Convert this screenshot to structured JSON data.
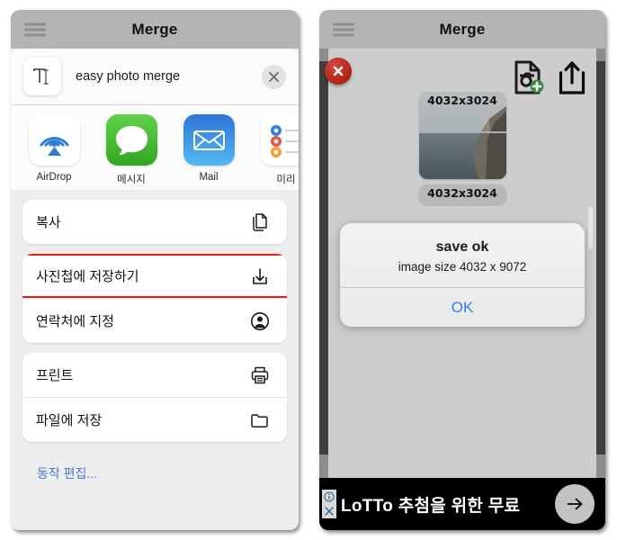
{
  "left_panel": {
    "titlebar": {
      "menu_icon": "hamburger-icon",
      "title": "Merge"
    },
    "share_sheet": {
      "app_icon": "text-cursor-icon",
      "app_name": "easy photo merge",
      "close_icon": "close-icon",
      "apps": [
        {
          "label": "AirDrop",
          "icon": "airdrop-icon"
        },
        {
          "label": "메시지",
          "icon": "messages-icon"
        },
        {
          "label": "Mail",
          "icon": "mail-icon"
        },
        {
          "label": "미리",
          "icon": "reminders-icon"
        }
      ],
      "groups": [
        {
          "rows": [
            {
              "label": "복사",
              "icon": "copy-icon",
              "highlighted": false
            }
          ]
        },
        {
          "rows": [
            {
              "label": "사진첩에 저장하기",
              "icon": "save-to-photos-icon",
              "highlighted": true
            },
            {
              "label": "연락처에 지정",
              "icon": "contact-icon",
              "highlighted": false
            }
          ]
        },
        {
          "rows": [
            {
              "label": "프린트",
              "icon": "printer-icon",
              "highlighted": false
            },
            {
              "label": "파일에 저장",
              "icon": "folder-icon",
              "highlighted": false
            }
          ]
        }
      ],
      "edit_actions_label": "동작 편집..."
    }
  },
  "right_panel": {
    "titlebar": {
      "menu_icon": "hamburger-icon",
      "title": "Merge"
    },
    "close_button_icon": "close-circle-icon",
    "toolbar": [
      {
        "icon": "add-photo-document-icon"
      },
      {
        "icon": "share-icon"
      }
    ],
    "thumbnails": [
      {
        "size_label": "4032x3024"
      },
      {
        "size_label": "4032x3024"
      }
    ],
    "alert": {
      "title": "save ok",
      "message": "image size 4032 x 9072",
      "button_label": "OK"
    },
    "ad": {
      "info_icon": "info-icon",
      "close_icon": "close-icon",
      "text": "LoTTo 추첨을 위한 무료",
      "cta_icon": "arrow-right-icon"
    }
  },
  "colors": {
    "titlebar": "#b4b4b4",
    "highlight_border": "#e02020",
    "link_blue": "#4a7ad6",
    "alert_button_blue": "#2d7bf4",
    "close_red": "#b31d14",
    "plus_green": "#3d8b3d"
  }
}
